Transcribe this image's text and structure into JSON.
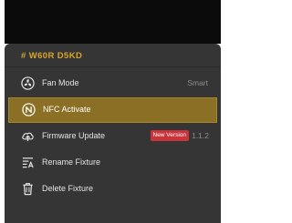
{
  "fixture": {
    "title": "# W60R D5KD"
  },
  "menu": {
    "items": [
      {
        "label": "Fan Mode",
        "value": "Smart",
        "icon": "fan-icon"
      },
      {
        "label": "NFC Activate",
        "icon": "nfc-icon",
        "selected": true
      },
      {
        "label": "Firmware Update",
        "badge": "New Version",
        "value": "1.1.2",
        "icon": "firmware-update-icon"
      },
      {
        "label": "Rename Fixture",
        "icon": "rename-icon"
      },
      {
        "label": "Delete Fixture",
        "icon": "trash-icon"
      }
    ]
  },
  "colors": {
    "accent": "#d9a52a",
    "selected_row": "#8a6f24",
    "panel_bg": "#353535",
    "badge_bg": "#c8343a"
  }
}
